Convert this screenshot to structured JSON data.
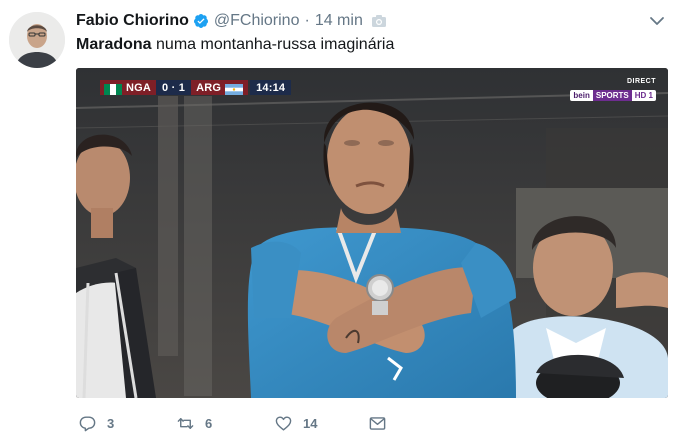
{
  "tweet": {
    "display_name": "Fabio Chiorino",
    "handle": "@FChiorino",
    "separator": "·",
    "time": "14 min",
    "text_bold": "Maradona",
    "text_rest": " numa montanha-russa imaginária"
  },
  "media": {
    "scorebug": {
      "team_a": "NGA",
      "score": "0 · 1",
      "team_b": "ARG",
      "clock": "14:14"
    },
    "broadcast": {
      "direct": "DIRECT",
      "logo_1": "bein",
      "logo_2": "SPORTS",
      "logo_3": "HD 1"
    }
  },
  "actions": {
    "replies": "3",
    "retweets": "6",
    "likes": "14"
  },
  "icons": {
    "verified": "verified-badge-icon",
    "camera": "camera-icon",
    "caret": "chevron-down-icon",
    "reply": "reply-icon",
    "retweet": "retweet-icon",
    "like": "heart-icon",
    "dm": "envelope-icon"
  },
  "colors": {
    "verified_blue": "#1da1f2",
    "muted": "#657786",
    "text": "#14171a",
    "jersey_blue": "#3a8fc4"
  }
}
